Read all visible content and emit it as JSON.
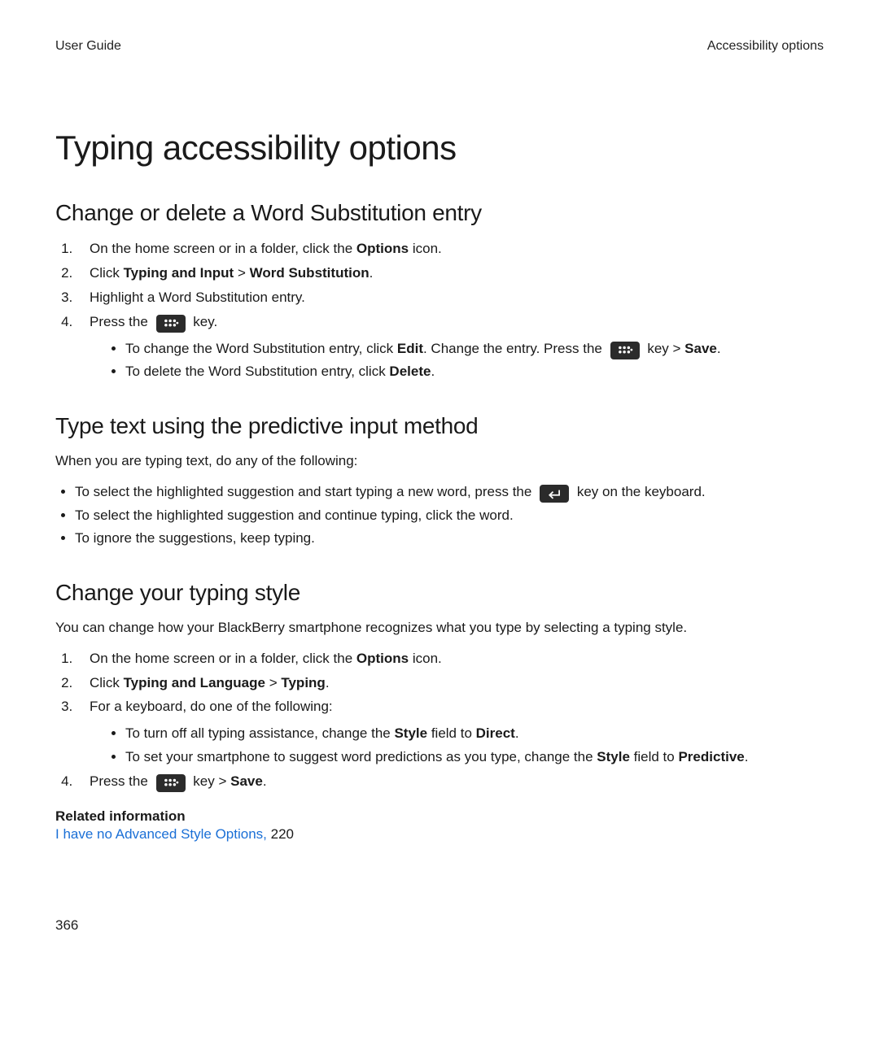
{
  "header": {
    "left": "User Guide",
    "right": "Accessibility options"
  },
  "title": "Typing accessibility options",
  "sections": {
    "wordsub": {
      "heading": "Change or delete a Word Substitution entry",
      "step1_pre": "On the home screen or in a folder, click the ",
      "step1_bold": "Options",
      "step1_post": " icon.",
      "step2_pre": "Click ",
      "step2_bold_a": "Typing and Input",
      "step2_mid": " > ",
      "step2_bold_b": "Word Substitution",
      "step2_post": ".",
      "step3": "Highlight a Word Substitution entry.",
      "step4_pre": "Press the ",
      "step4_post": " key.",
      "sub1_pre": "To change the Word Substitution entry, click ",
      "sub1_bold_a": "Edit",
      "sub1_mid": ". Change the entry. Press the ",
      "sub1_post_keymid": " key > ",
      "sub1_bold_b": "Save",
      "sub1_post": ".",
      "sub2_pre": "To delete the Word Substitution entry, click ",
      "sub2_bold": "Delete",
      "sub2_post": "."
    },
    "predictive": {
      "heading": "Type text using the predictive input method",
      "intro": "When you are typing text, do any of the following:",
      "b1_pre": "To select the highlighted suggestion and start typing a new word, press the ",
      "b1_post": " key on the keyboard.",
      "b2": "To select the highlighted suggestion and continue typing, click the word.",
      "b3": "To ignore the suggestions, keep typing."
    },
    "style": {
      "heading": "Change your typing style",
      "intro": "You can change how your BlackBerry smartphone recognizes what you type by selecting a typing style.",
      "step1_pre": "On the home screen or in a folder, click the ",
      "step1_bold": "Options",
      "step1_post": " icon.",
      "step2_pre": "Click ",
      "step2_bold_a": "Typing and Language",
      "step2_mid": " > ",
      "step2_bold_b": "Typing",
      "step2_post": ".",
      "step3": "For a keyboard, do one of the following:",
      "sub1_pre": "To turn off all typing assistance, change the ",
      "sub1_bold_a": "Style",
      "sub1_mid": " field to ",
      "sub1_bold_b": "Direct",
      "sub1_post": ".",
      "sub2_pre": "To set your smartphone to suggest word predictions as you type, change the ",
      "sub2_bold_a": "Style",
      "sub2_mid": " field to ",
      "sub2_bold_b": "Predictive",
      "sub2_post": ".",
      "step4_pre": "Press the ",
      "step4_mid": " key > ",
      "step4_bold": "Save",
      "step4_post": "."
    },
    "related": {
      "heading": "Related information",
      "link_text": "I have no Advanced Style Options,",
      "page_ref": " 220"
    }
  },
  "page_number": "366"
}
